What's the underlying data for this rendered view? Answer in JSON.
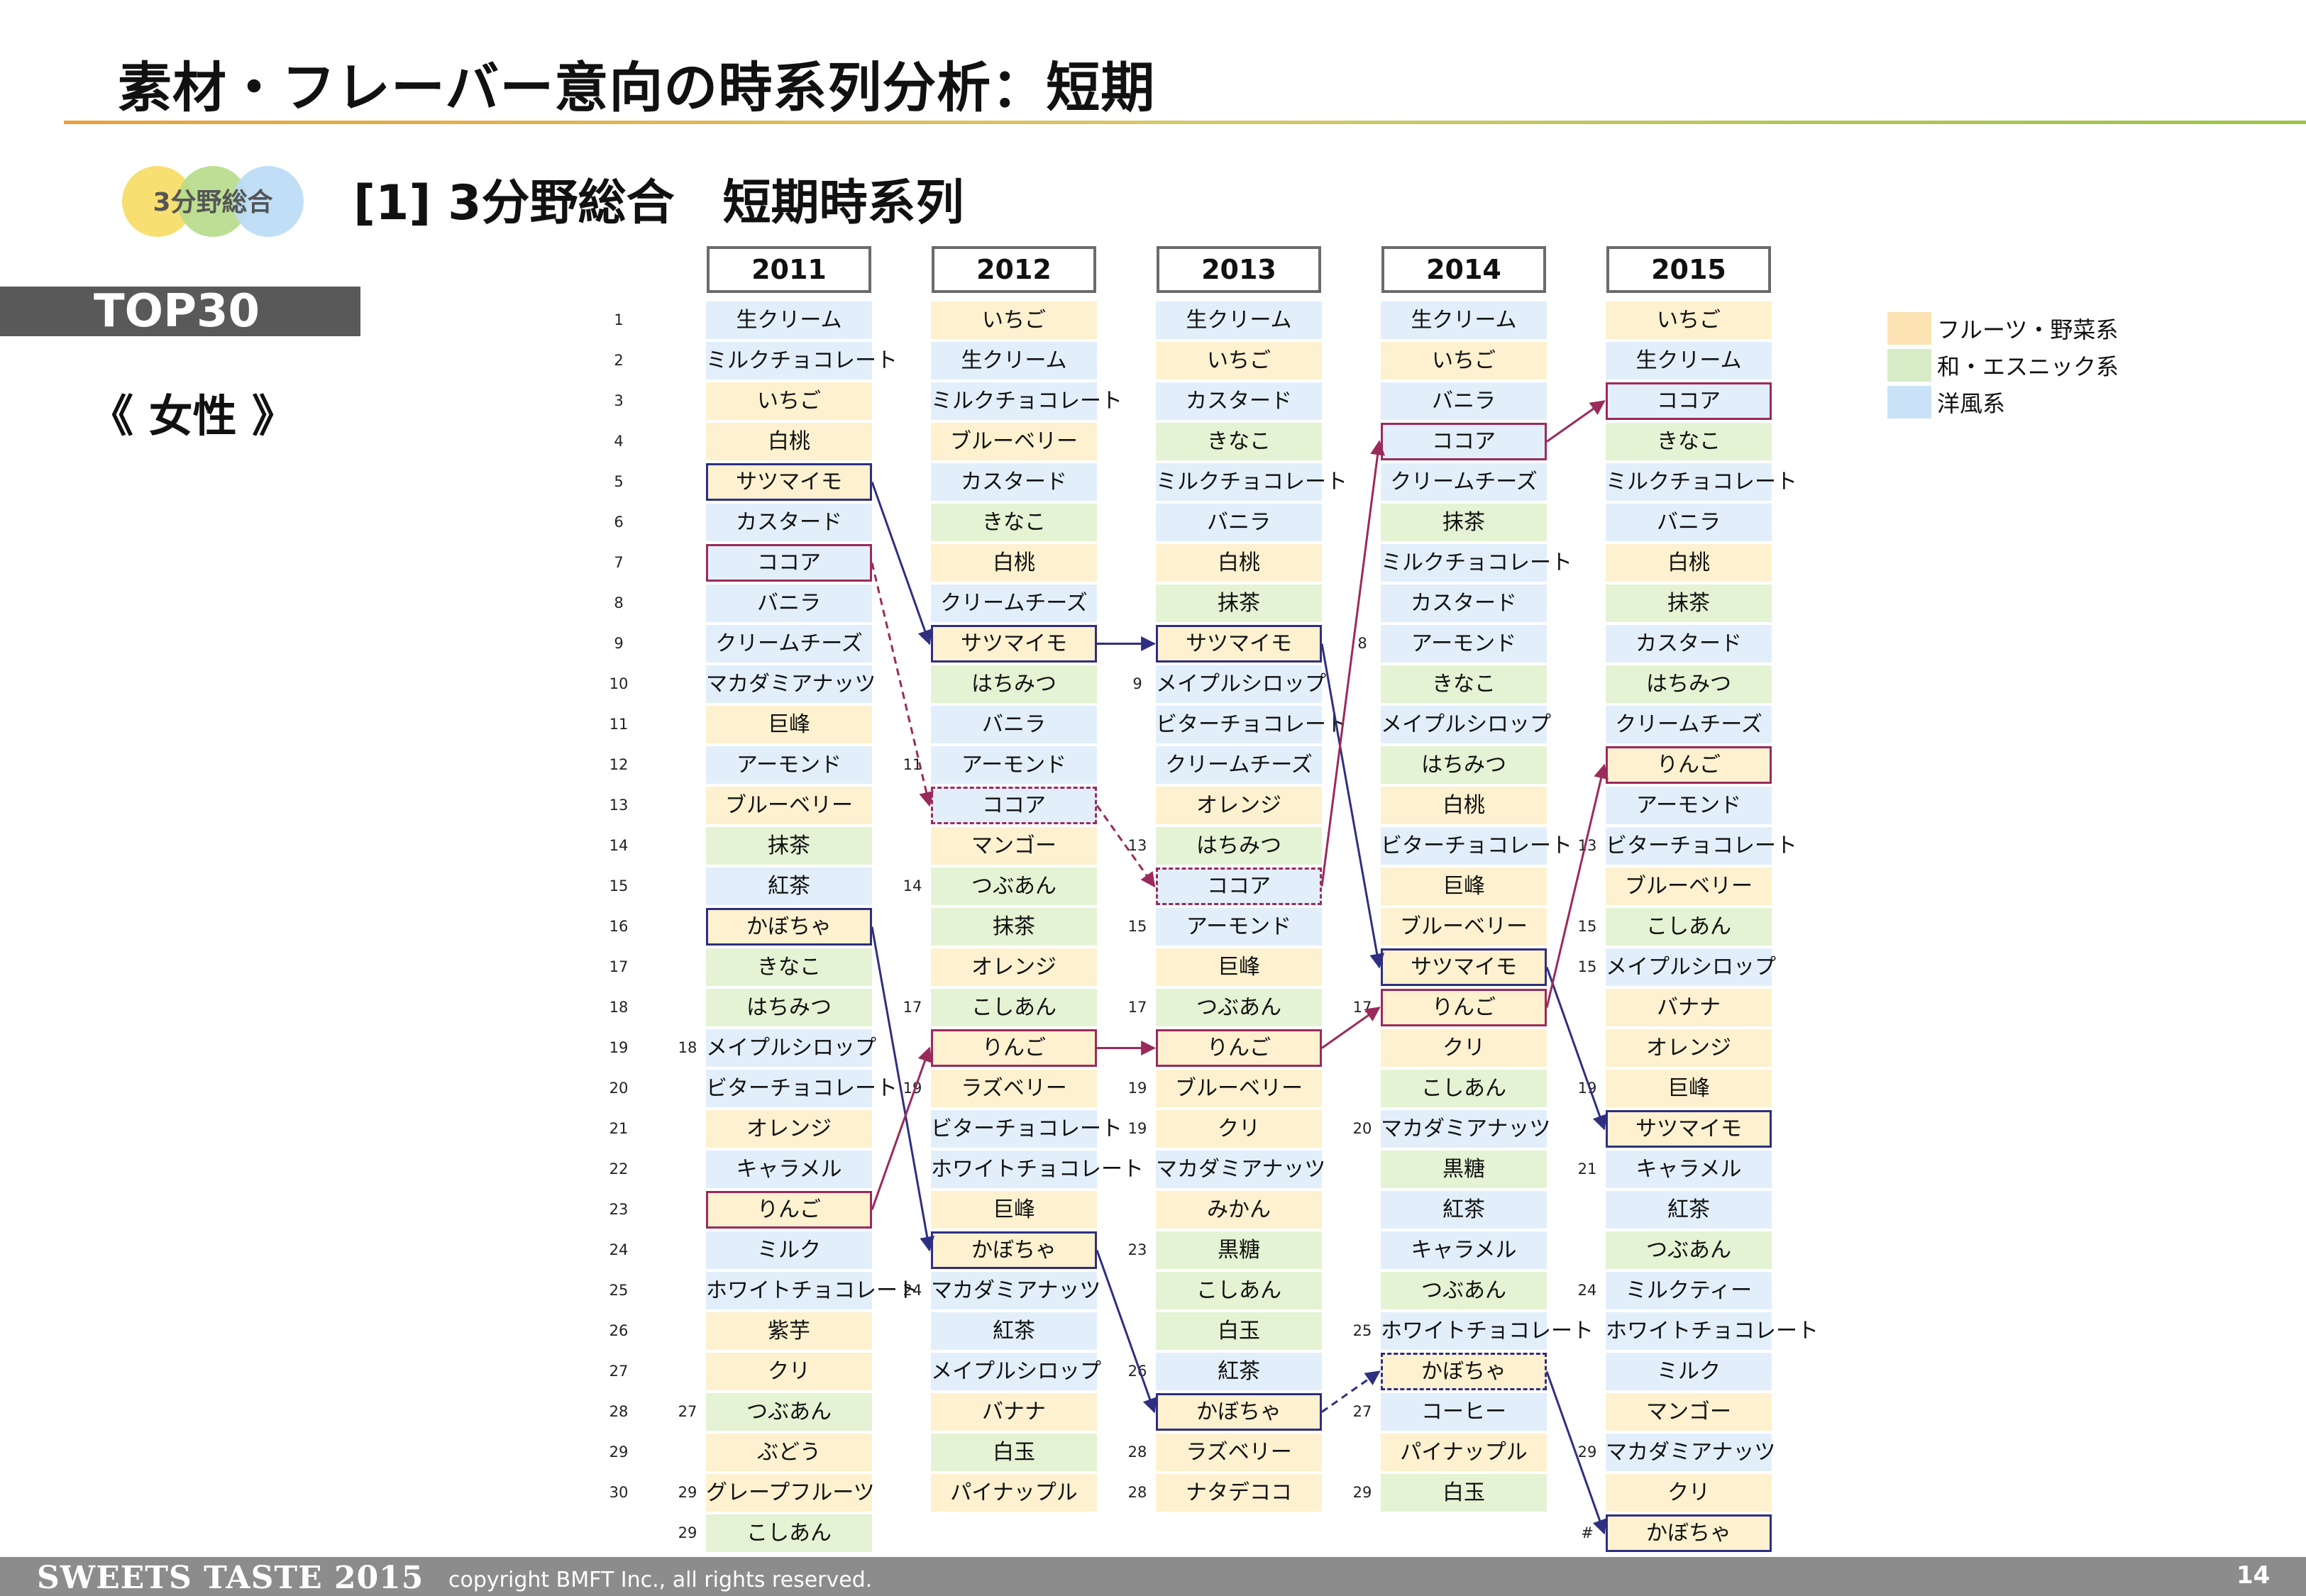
{
  "title": "素材・フレーバー意向の時系列分析：短期",
  "badge": "3分野総合",
  "section_title": "[1] 3分野総合　短期時系列",
  "top_label": "TOP30",
  "gender_label": "《 女性 》",
  "colors": {
    "fruit": "#fdf1cf",
    "wa": "#e4f3d3",
    "western": "#e2effb",
    "highlight_blue": "#2e2f80",
    "highlight_red": "#9b2a5c"
  },
  "legend": [
    {
      "label": "フルーツ・野菜系",
      "color": "#fde3b4"
    },
    {
      "label": "和・エスニック系",
      "color": "#d7ecc6"
    },
    {
      "label": "洋風系",
      "color": "#c9e2f8"
    }
  ],
  "ranks": [
    "1",
    "2",
    "3",
    "4",
    "5",
    "6",
    "7",
    "8",
    "9",
    "10",
    "11",
    "12",
    "13",
    "14",
    "15",
    "16",
    "17",
    "18",
    "19",
    "20",
    "21",
    "22",
    "23",
    "24",
    "25",
    "26",
    "27",
    "28",
    "29",
    "30"
  ],
  "years": [
    {
      "year": "2011",
      "items": [
        {
          "name": "生クリーム",
          "cat": "w"
        },
        {
          "name": "ミルクチョコレート",
          "cat": "w"
        },
        {
          "name": "いちご",
          "cat": "f"
        },
        {
          "name": "白桃",
          "cat": "f"
        },
        {
          "name": "サツマイモ",
          "cat": "f",
          "box": "blue"
        },
        {
          "name": "カスタード",
          "cat": "w"
        },
        {
          "name": "ココア",
          "cat": "w",
          "box": "red"
        },
        {
          "name": "バニラ",
          "cat": "w"
        },
        {
          "name": "クリームチーズ",
          "cat": "w"
        },
        {
          "name": "マカダミアナッツ",
          "cat": "w"
        },
        {
          "name": "巨峰",
          "cat": "f"
        },
        {
          "name": "アーモンド",
          "cat": "w"
        },
        {
          "name": "ブルーベリー",
          "cat": "f"
        },
        {
          "name": "抹茶",
          "cat": "j"
        },
        {
          "name": "紅茶",
          "cat": "w"
        },
        {
          "name": "かぼちゃ",
          "cat": "f",
          "box": "blue"
        },
        {
          "name": "きなこ",
          "cat": "j"
        },
        {
          "name": "はちみつ",
          "cat": "j"
        },
        {
          "name": "メイプルシロップ",
          "cat": "w",
          "tie": "18"
        },
        {
          "name": "ビターチョコレート",
          "cat": "w"
        },
        {
          "name": "オレンジ",
          "cat": "f"
        },
        {
          "name": "キャラメル",
          "cat": "w"
        },
        {
          "name": "りんご",
          "cat": "f",
          "box": "red"
        },
        {
          "name": "ミルク",
          "cat": "w"
        },
        {
          "name": "ホワイトチョコレート",
          "cat": "w"
        },
        {
          "name": "紫芋",
          "cat": "f"
        },
        {
          "name": "クリ",
          "cat": "f"
        },
        {
          "name": "つぶあん",
          "cat": "j",
          "tie": "27"
        },
        {
          "name": "ぶどう",
          "cat": "f"
        },
        {
          "name": "グレープフルーツ",
          "cat": "f",
          "tie": "29"
        },
        {
          "name": "こしあん",
          "cat": "j",
          "tie": "29"
        }
      ]
    },
    {
      "year": "2012",
      "items": [
        {
          "name": "いちご",
          "cat": "f"
        },
        {
          "name": "生クリーム",
          "cat": "w"
        },
        {
          "name": "ミルクチョコレート",
          "cat": "w"
        },
        {
          "name": "ブルーベリー",
          "cat": "f"
        },
        {
          "name": "カスタード",
          "cat": "w"
        },
        {
          "name": "きなこ",
          "cat": "j"
        },
        {
          "name": "白桃",
          "cat": "f"
        },
        {
          "name": "クリームチーズ",
          "cat": "w"
        },
        {
          "name": "サツマイモ",
          "cat": "f",
          "box": "blue"
        },
        {
          "name": "はちみつ",
          "cat": "j"
        },
        {
          "name": "バニラ",
          "cat": "w"
        },
        {
          "name": "アーモンド",
          "cat": "w",
          "tie": "11"
        },
        {
          "name": "ココア",
          "cat": "w",
          "box": "red-dash"
        },
        {
          "name": "マンゴー",
          "cat": "f"
        },
        {
          "name": "つぶあん",
          "cat": "j",
          "tie": "14"
        },
        {
          "name": "抹茶",
          "cat": "j"
        },
        {
          "name": "オレンジ",
          "cat": "f"
        },
        {
          "name": "こしあん",
          "cat": "j",
          "tie": "17"
        },
        {
          "name": "りんご",
          "cat": "f",
          "box": "red"
        },
        {
          "name": "ラズベリー",
          "cat": "f",
          "tie": "19"
        },
        {
          "name": "ビターチョコレート",
          "cat": "w"
        },
        {
          "name": "ホワイトチョコレート",
          "cat": "w"
        },
        {
          "name": "巨峰",
          "cat": "f"
        },
        {
          "name": "かぼちゃ",
          "cat": "f",
          "box": "blue"
        },
        {
          "name": "マカダミアナッツ",
          "cat": "w",
          "tie": "24"
        },
        {
          "name": "紅茶",
          "cat": "w"
        },
        {
          "name": "メイプルシロップ",
          "cat": "w"
        },
        {
          "name": "バナナ",
          "cat": "f"
        },
        {
          "name": "白玉",
          "cat": "j"
        },
        {
          "name": "パイナップル",
          "cat": "f"
        }
      ]
    },
    {
      "year": "2013",
      "items": [
        {
          "name": "生クリーム",
          "cat": "w"
        },
        {
          "name": "いちご",
          "cat": "f"
        },
        {
          "name": "カスタード",
          "cat": "w"
        },
        {
          "name": "きなこ",
          "cat": "j"
        },
        {
          "name": "ミルクチョコレート",
          "cat": "w"
        },
        {
          "name": "バニラ",
          "cat": "w"
        },
        {
          "name": "白桃",
          "cat": "f"
        },
        {
          "name": "抹茶",
          "cat": "j"
        },
        {
          "name": "サツマイモ",
          "cat": "f",
          "box": "blue"
        },
        {
          "name": "メイプルシロップ",
          "cat": "w",
          "tie": "9"
        },
        {
          "name": "ビターチョコレート",
          "cat": "w"
        },
        {
          "name": "クリームチーズ",
          "cat": "w"
        },
        {
          "name": "オレンジ",
          "cat": "f"
        },
        {
          "name": "はちみつ",
          "cat": "j",
          "tie": "13"
        },
        {
          "name": "ココア",
          "cat": "w",
          "box": "red-dash"
        },
        {
          "name": "アーモンド",
          "cat": "w",
          "tie": "15"
        },
        {
          "name": "巨峰",
          "cat": "f"
        },
        {
          "name": "つぶあん",
          "cat": "j",
          "tie": "17"
        },
        {
          "name": "りんご",
          "cat": "f",
          "box": "red"
        },
        {
          "name": "ブルーベリー",
          "cat": "f",
          "tie": "19"
        },
        {
          "name": "クリ",
          "cat": "f",
          "tie": "19"
        },
        {
          "name": "マカダミアナッツ",
          "cat": "w"
        },
        {
          "name": "みかん",
          "cat": "f"
        },
        {
          "name": "黒糖",
          "cat": "j",
          "tie": "23"
        },
        {
          "name": "こしあん",
          "cat": "j"
        },
        {
          "name": "白玉",
          "cat": "j"
        },
        {
          "name": "紅茶",
          "cat": "w",
          "tie": "26"
        },
        {
          "name": "かぼちゃ",
          "cat": "f",
          "box": "blue"
        },
        {
          "name": "ラズベリー",
          "cat": "f",
          "tie": "28"
        },
        {
          "name": "ナタデココ",
          "cat": "f",
          "tie": "28"
        }
      ]
    },
    {
      "year": "2014",
      "items": [
        {
          "name": "生クリーム",
          "cat": "w"
        },
        {
          "name": "いちご",
          "cat": "f"
        },
        {
          "name": "バニラ",
          "cat": "w"
        },
        {
          "name": "ココア",
          "cat": "w",
          "box": "red"
        },
        {
          "name": "クリームチーズ",
          "cat": "w"
        },
        {
          "name": "抹茶",
          "cat": "j"
        },
        {
          "name": "ミルクチョコレート",
          "cat": "w"
        },
        {
          "name": "カスタード",
          "cat": "w"
        },
        {
          "name": "アーモンド",
          "cat": "w",
          "tie": "8"
        },
        {
          "name": "きなこ",
          "cat": "j"
        },
        {
          "name": "メイプルシロップ",
          "cat": "w"
        },
        {
          "name": "はちみつ",
          "cat": "j"
        },
        {
          "name": "白桃",
          "cat": "f"
        },
        {
          "name": "ビターチョコレート",
          "cat": "w"
        },
        {
          "name": "巨峰",
          "cat": "f"
        },
        {
          "name": "ブルーベリー",
          "cat": "f"
        },
        {
          "name": "サツマイモ",
          "cat": "f",
          "box": "blue"
        },
        {
          "name": "りんご",
          "cat": "f",
          "box": "red",
          "tie": "17"
        },
        {
          "name": "クリ",
          "cat": "f"
        },
        {
          "name": "こしあん",
          "cat": "j"
        },
        {
          "name": "マカダミアナッツ",
          "cat": "w",
          "tie": "20"
        },
        {
          "name": "黒糖",
          "cat": "j"
        },
        {
          "name": "紅茶",
          "cat": "w"
        },
        {
          "name": "キャラメル",
          "cat": "w"
        },
        {
          "name": "つぶあん",
          "cat": "j"
        },
        {
          "name": "ホワイトチョコレート",
          "cat": "w",
          "tie": "25"
        },
        {
          "name": "かぼちゃ",
          "cat": "f",
          "box": "blue-dash"
        },
        {
          "name": "コーヒー",
          "cat": "w",
          "tie": "27"
        },
        {
          "name": "パイナップル",
          "cat": "f"
        },
        {
          "name": "白玉",
          "cat": "j",
          "tie": "29"
        }
      ]
    },
    {
      "year": "2015",
      "items": [
        {
          "name": "いちご",
          "cat": "f"
        },
        {
          "name": "生クリーム",
          "cat": "w"
        },
        {
          "name": "ココア",
          "cat": "w",
          "box": "red"
        },
        {
          "name": "きなこ",
          "cat": "j"
        },
        {
          "name": "ミルクチョコレート",
          "cat": "w"
        },
        {
          "name": "バニラ",
          "cat": "w"
        },
        {
          "name": "白桃",
          "cat": "f"
        },
        {
          "name": "抹茶",
          "cat": "j"
        },
        {
          "name": "カスタード",
          "cat": "w"
        },
        {
          "name": "はちみつ",
          "cat": "j"
        },
        {
          "name": "クリームチーズ",
          "cat": "w"
        },
        {
          "name": "りんご",
          "cat": "f",
          "box": "red"
        },
        {
          "name": "アーモンド",
          "cat": "w"
        },
        {
          "name": "ビターチョコレート",
          "cat": "w",
          "tie": "13"
        },
        {
          "name": "ブルーベリー",
          "cat": "f"
        },
        {
          "name": "こしあん",
          "cat": "j",
          "tie": "15"
        },
        {
          "name": "メイプルシロップ",
          "cat": "w",
          "tie": "15"
        },
        {
          "name": "バナナ",
          "cat": "f"
        },
        {
          "name": "オレンジ",
          "cat": "f"
        },
        {
          "name": "巨峰",
          "cat": "f",
          "tie": "19"
        },
        {
          "name": "サツマイモ",
          "cat": "f",
          "box": "blue"
        },
        {
          "name": "キャラメル",
          "cat": "w",
          "tie": "21"
        },
        {
          "name": "紅茶",
          "cat": "w"
        },
        {
          "name": "つぶあん",
          "cat": "j"
        },
        {
          "name": "ミルクティー",
          "cat": "w",
          "tie": "24"
        },
        {
          "name": "ホワイトチョコレート",
          "cat": "w"
        },
        {
          "name": "ミルク",
          "cat": "w"
        },
        {
          "name": "マンゴー",
          "cat": "f"
        },
        {
          "name": "マカダミアナッツ",
          "cat": "w",
          "tie": "29"
        },
        {
          "name": "クリ",
          "cat": "f"
        },
        {
          "name": "かぼちゃ",
          "cat": "f",
          "box": "blue",
          "tie": "#"
        }
      ]
    }
  ],
  "arrows": [
    {
      "series": "sweet-potato",
      "color": "blue",
      "dash": false,
      "path": [
        [
          0,
          4
        ],
        [
          1,
          8
        ],
        [
          2,
          8
        ],
        [
          3,
          16
        ],
        [
          4,
          20
        ]
      ]
    },
    {
      "series": "pumpkin",
      "color": "blue",
      "dash": false,
      "path": [
        [
          0,
          15
        ],
        [
          1,
          23
        ],
        [
          2,
          27
        ]
      ]
    },
    {
      "series": "pumpkin",
      "color": "blue",
      "dash": true,
      "path": [
        [
          2,
          27
        ],
        [
          3,
          26
        ]
      ]
    },
    {
      "series": "pumpkin",
      "color": "blue",
      "dash": false,
      "path": [
        [
          3,
          26
        ],
        [
          4,
          30
        ]
      ]
    },
    {
      "series": "cocoa",
      "color": "red",
      "dash": true,
      "path": [
        [
          0,
          6
        ],
        [
          1,
          12
        ],
        [
          2,
          14
        ]
      ]
    },
    {
      "series": "cocoa",
      "color": "red",
      "dash": false,
      "path": [
        [
          2,
          14
        ],
        [
          3,
          3
        ],
        [
          4,
          2
        ]
      ]
    },
    {
      "series": "apple",
      "color": "red",
      "dash": false,
      "path": [
        [
          0,
          22
        ],
        [
          1,
          18
        ],
        [
          2,
          18
        ],
        [
          3,
          17
        ],
        [
          4,
          11
        ]
      ]
    }
  ],
  "footer": {
    "brand": "SWEETS TASTE 2015",
    "copyright": "copyright  BMFT Inc., all rights reserved.",
    "page": "14"
  }
}
